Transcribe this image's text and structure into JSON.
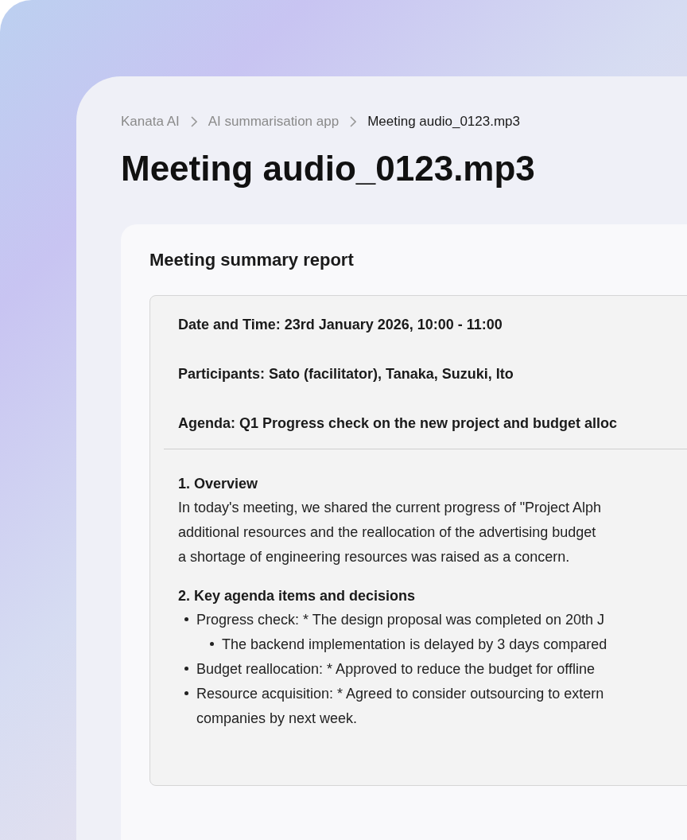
{
  "breadcrumb": [
    {
      "label": "Kanata AI",
      "current": false
    },
    {
      "label": "AI summarisation app",
      "current": false
    },
    {
      "label": "Meeting audio_0123.mp3",
      "current": true
    }
  ],
  "title": "Meeting audio_0123.mp3",
  "report": {
    "heading": "Meeting summary report",
    "meta": [
      "Date and Time: 23rd January 2026, 10:00 - 11:00",
      "Participants: Sato (facilitator), Tanaka, Suzuki, Ito",
      "Agenda: Q1 Progress check on the new project and budget alloc"
    ],
    "sections": [
      {
        "heading": "1. Overview",
        "lines": [
          "In today's meeting, we shared the current progress of \"Project Alph",
          "additional resources and the reallocation of the advertising budget",
          "a shortage of engineering resources was raised as a concern."
        ]
      },
      {
        "heading": "2. Key agenda items and decisions",
        "bullets": [
          {
            "lines": [
              "Progress check: * The design proposal was completed on 20th J"
            ],
            "children": [
              {
                "lines": [
                  "The backend implementation is delayed by 3 days compared"
                ]
              }
            ]
          },
          {
            "lines": [
              "Budget reallocation: * Approved to reduce the budget for offline"
            ]
          },
          {
            "lines": [
              "Resource acquisition: * Agreed to consider outsourcing to extern",
              "companies by next week."
            ]
          }
        ]
      }
    ]
  }
}
